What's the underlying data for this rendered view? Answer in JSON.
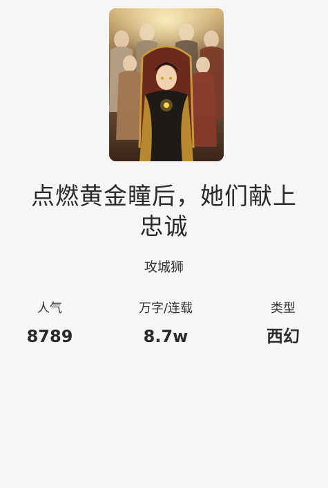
{
  "book": {
    "title": "点燃黄金瞳后，她们献上忠诚",
    "author": "攻城狮",
    "cover_alt": "book-cover-image"
  },
  "stats": {
    "popularity_label": "人气",
    "popularity_value": "8789",
    "words_label": "万字/连载",
    "words_value": "8.7w",
    "genre_label": "类型",
    "genre_value": "西幻"
  },
  "colors": {
    "background": "#f6f6f6",
    "text": "#2b2b2b"
  }
}
